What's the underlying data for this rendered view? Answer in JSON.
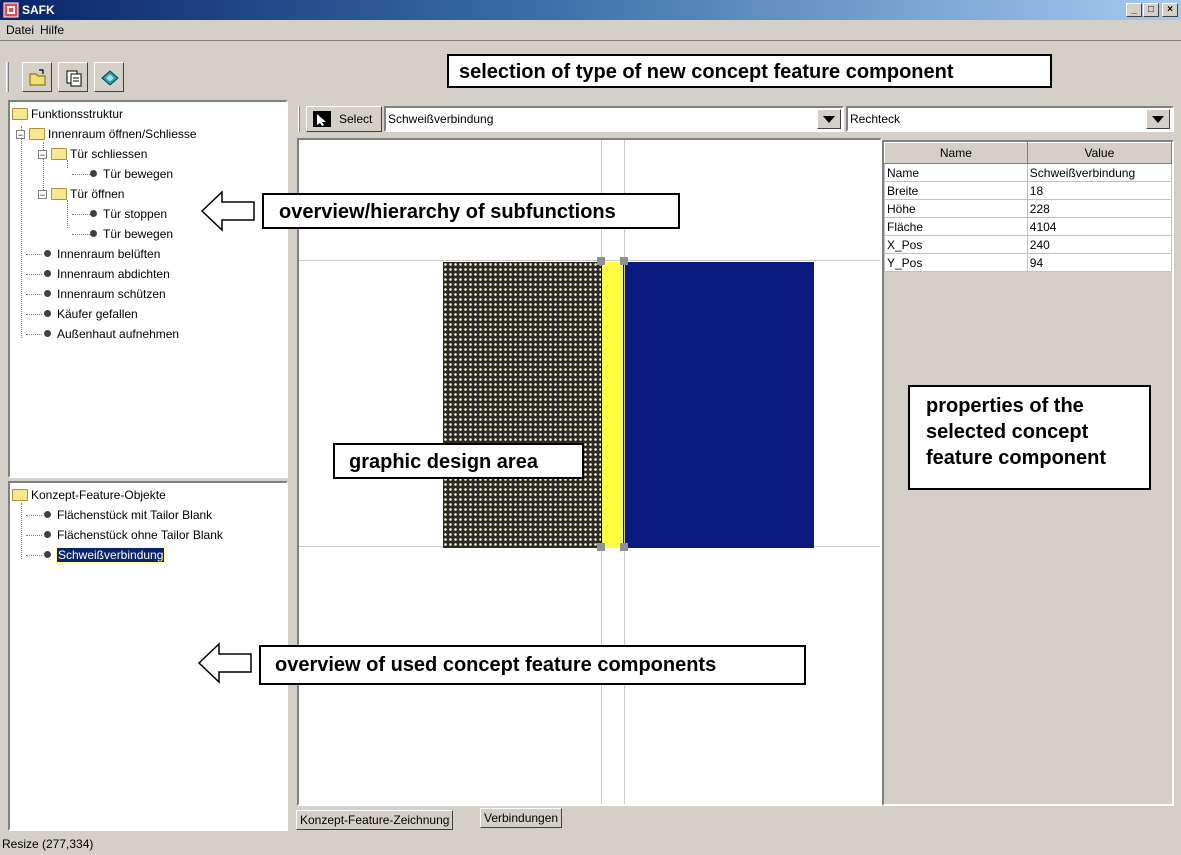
{
  "window": {
    "title": "SAFK",
    "min_glyph": "_",
    "max_glyph": "□",
    "close_glyph": "×"
  },
  "menu": {
    "file": "Datei",
    "help": "Hilfe"
  },
  "toolbar": {
    "icons": [
      "open-folder-icon",
      "copy-document-icon",
      "book-icon"
    ]
  },
  "function_tree": {
    "root": "Funktionsstruktur",
    "items": [
      {
        "label": "Innenraum öffnen/Schliesse",
        "type": "folder",
        "expanded": true
      },
      {
        "label": "Tür schliessen",
        "type": "folder",
        "expanded": true
      },
      {
        "label": "Tür bewegen",
        "type": "leaf"
      },
      {
        "label": "Tür öffnen",
        "type": "folder",
        "expanded": true
      },
      {
        "label": "Tür stoppen",
        "type": "leaf"
      },
      {
        "label": "Tür bewegen",
        "type": "leaf"
      },
      {
        "label": "Innenraum belüften",
        "type": "leaf"
      },
      {
        "label": "Innenraum abdichten",
        "type": "leaf"
      },
      {
        "label": "Innenraum schützen",
        "type": "leaf"
      },
      {
        "label": "Käufer gefallen",
        "type": "leaf"
      },
      {
        "label": "Außenhaut aufnehmen",
        "type": "leaf"
      }
    ]
  },
  "component_tree": {
    "root": "Konzept-Feature-Objekte",
    "items": [
      {
        "label": "Flächenstück mit Tailor Blank",
        "selected": false
      },
      {
        "label": "Flächenstück ohne Tailor Blank",
        "selected": false
      },
      {
        "label": "Schweißverbindung",
        "selected": true
      }
    ]
  },
  "design_toolbar": {
    "select_label": "Select",
    "component_type": "Schweißverbindung",
    "shape": "Rechteck"
  },
  "properties": {
    "headers": [
      "Name",
      "Value"
    ],
    "rows": [
      [
        "Name",
        "Schweißverbindung"
      ],
      [
        "Breite",
        "18"
      ],
      [
        "Höhe",
        "228"
      ],
      [
        "Fläche",
        "4104"
      ],
      [
        "X_Pos",
        "240"
      ],
      [
        "Y_Pos",
        "94"
      ]
    ]
  },
  "tabs": [
    "Konzept-Feature-Zeichnung",
    "Verbindungen"
  ],
  "status_bar": "Resize (277,334)",
  "colors": {
    "weld_yellow": "#ffff40",
    "blank_navy": "#0a1a80",
    "mesh_dark": "#2a2a2a",
    "title_bar": "#0a246a"
  },
  "annotations": {
    "type_selection": "selection of type of new concept feature component",
    "hierarchy": "overview/hierarchy of subfunctions",
    "design_area": "graphic design area",
    "properties": "properties of the selected concept feature component",
    "used_components": "overview of used concept feature components"
  }
}
